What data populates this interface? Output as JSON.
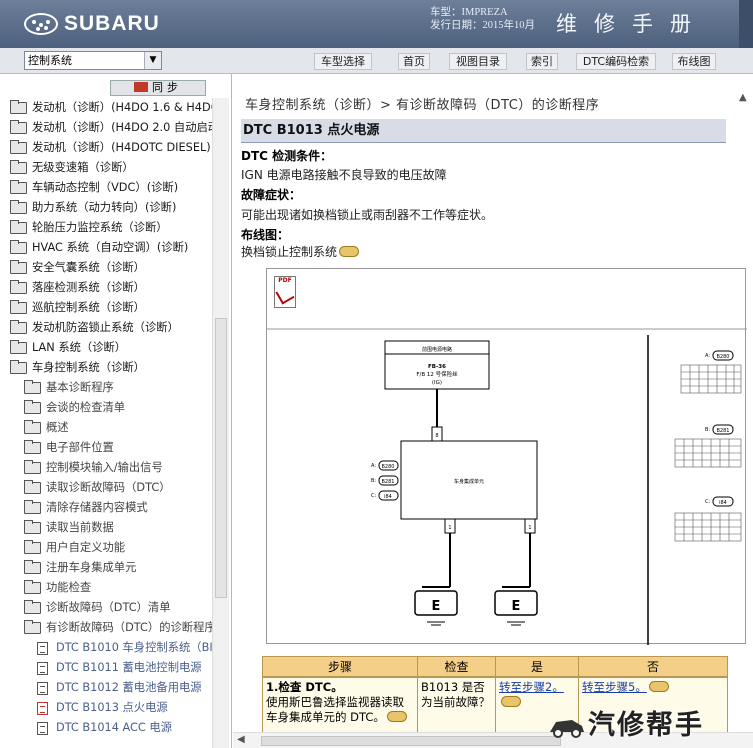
{
  "header": {
    "brand": "SUBARU",
    "model_line": "车型：IMPREZA",
    "date_line": "发行日期：2015年10月",
    "manual_title": "维修手册"
  },
  "toolbar": {
    "select_value": "控制系统",
    "buttons": [
      "车型选择",
      "首页",
      "视图目录",
      "索引",
      "DTC编码检索",
      "布线图"
    ]
  },
  "sync_label": "同步",
  "tree": [
    {
      "label": "发动机（诊断）(H4DO 1.6 & H4DO",
      "level": 0,
      "icon": "folder"
    },
    {
      "label": "发动机（诊断）(H4DO 2.0 自动启动",
      "level": 0,
      "icon": "folder"
    },
    {
      "label": "发动机（诊断）(H4DOTC DIESEL)",
      "level": 0,
      "icon": "folder"
    },
    {
      "label": "无级变速箱（诊断）",
      "level": 0,
      "icon": "folder"
    },
    {
      "label": "车辆动态控制（VDC）(诊断)",
      "level": 0,
      "icon": "folder"
    },
    {
      "label": "助力系统（动力转向）(诊断)",
      "level": 0,
      "icon": "folder"
    },
    {
      "label": "轮胎压力监控系统（诊断）",
      "level": 0,
      "icon": "folder"
    },
    {
      "label": "HVAC 系统（自动空调）(诊断)",
      "level": 0,
      "icon": "folder"
    },
    {
      "label": "安全气囊系统（诊断）",
      "level": 0,
      "icon": "folder"
    },
    {
      "label": "落座检测系统（诊断）",
      "level": 0,
      "icon": "folder"
    },
    {
      "label": "巡航控制系统（诊断）",
      "level": 0,
      "icon": "folder"
    },
    {
      "label": "发动机防盗锁止系统（诊断）",
      "level": 0,
      "icon": "folder"
    },
    {
      "label": "LAN 系统（诊断）",
      "level": 0,
      "icon": "folder"
    },
    {
      "label": "车身控制系统（诊断）",
      "level": 0,
      "icon": "folder-open"
    },
    {
      "label": "基本诊断程序",
      "level": 1,
      "icon": "folder"
    },
    {
      "label": "会谈的检查清单",
      "level": 1,
      "icon": "folder"
    },
    {
      "label": "概述",
      "level": 1,
      "icon": "folder"
    },
    {
      "label": "电子部件位置",
      "level": 1,
      "icon": "folder"
    },
    {
      "label": "控制模块输入/输出信号",
      "level": 1,
      "icon": "folder"
    },
    {
      "label": "读取诊断故障码（DTC）",
      "level": 1,
      "icon": "folder"
    },
    {
      "label": "清除存储器内容模式",
      "level": 1,
      "icon": "folder"
    },
    {
      "label": "读取当前数据",
      "level": 1,
      "icon": "folder"
    },
    {
      "label": "用户自定义功能",
      "level": 1,
      "icon": "folder"
    },
    {
      "label": "注册车身集成单元",
      "level": 1,
      "icon": "folder"
    },
    {
      "label": "功能检查",
      "level": 1,
      "icon": "folder"
    },
    {
      "label": "诊断故障码（DTC）清单",
      "level": 1,
      "icon": "folder"
    },
    {
      "label": "有诊断故障码（DTC）的诊断程序",
      "level": 1,
      "icon": "folder-open"
    },
    {
      "label": "DTC B1010 车身控制系统（BI",
      "level": 2,
      "icon": "doc"
    },
    {
      "label": "DTC B1011 蓄电池控制电源",
      "level": 2,
      "icon": "doc"
    },
    {
      "label": "DTC B1012 蓄电池备用电源",
      "level": 2,
      "icon": "doc"
    },
    {
      "label": "DTC B1013 点火电源",
      "level": 2,
      "icon": "doc-red"
    },
    {
      "label": "DTC B1014 ACC 电源",
      "level": 2,
      "icon": "doc"
    }
  ],
  "content": {
    "breadcrumb": "车身控制系统（诊断）> 有诊断故障码（DTC）的诊断程序",
    "dtc_title": "DTC B1013 点火电源",
    "cond_label": "DTC 检测条件：",
    "cond_text": "IGN 电源电路接触不良导致的电压故障",
    "symptom_label": "故障症状：",
    "symptom_text": "可能出现诸如换档锁止或雨刮器不工作等症状。",
    "wiring_label": "布线图：",
    "wiring_text": "换档锁止控制系统",
    "pdf_label": "PDF"
  },
  "diagram": {
    "fuse_box_title": "前围电源电路",
    "fuse_line1": "FB-36",
    "fuse_line2": "F/B 12 号保险丝",
    "fuse_line3": "(IG)",
    "unit_label": "车身集成单元",
    "connectors": [
      "B280",
      "B281",
      "i84"
    ],
    "conn_prefix": [
      "A:",
      "B:",
      "C:"
    ],
    "ground_label": "E",
    "pin_labels": [
      "8",
      "1",
      "1"
    ]
  },
  "table": {
    "headers": [
      "步骤",
      "检查",
      "是",
      "否"
    ],
    "step_title": "1.检查 DTC。",
    "step_text": "使用斯巴鲁选择监视器读取车身集成单元的 DTC。",
    "check_text": "B1013 是否为当前故障？",
    "yes_link": "转至步骤2。",
    "no_link": "转至步骤5。"
  },
  "watermark": "汽修帮手"
}
